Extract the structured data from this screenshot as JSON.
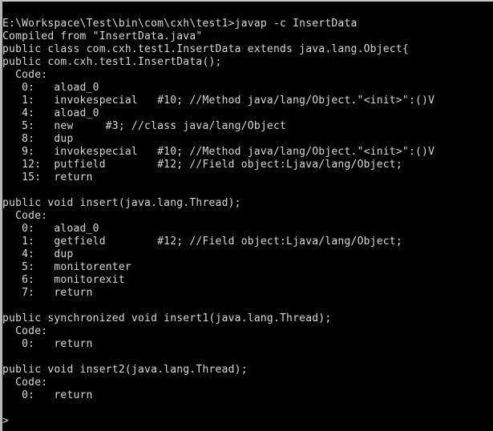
{
  "window": {
    "kind": "windows-command-prompt",
    "background_color": "#000000",
    "text_color": "#d8d8d8",
    "border_color": "#c6c6c6",
    "columns": 74,
    "rows": 32
  },
  "terminal": {
    "prompt_path": "E:\\Workspace\\Test\\bin\\com\\cxh\\test1>",
    "command": "javap -c InsertData",
    "final_prompt": ">",
    "lines": [
      "E:\\Workspace\\Test\\bin\\com\\cxh\\test1>javap -c InsertData",
      "Compiled from \"InsertData.java\"",
      "public class com.cxh.test1.InsertData extends java.lang.Object{",
      "public com.cxh.test1.InsertData();",
      "  Code:",
      "   0:   aload_0",
      "   1:   invokespecial   #10; //Method java/lang/Object.\"<init>\":()V",
      "   4:   aload_0",
      "   5:   new     #3; //class java/lang/Object",
      "   8:   dup",
      "   9:   invokespecial   #10; //Method java/lang/Object.\"<init>\":()V",
      "   12:  putfield        #12; //Field object:Ljava/lang/Object;",
      "   15:  return",
      "",
      "public void insert(java.lang.Thread);",
      "  Code:",
      "   0:   aload_0",
      "   1:   getfield        #12; //Field object:Ljava/lang/Object;",
      "   4:   dup",
      "   5:   monitorenter",
      "   6:   monitorexit",
      "   7:   return",
      "",
      "public synchronized void insert1(java.lang.Thread);",
      "  Code:",
      "   0:   return",
      "",
      "public void insert2(java.lang.Thread);",
      "  Code:",
      "   0:   return",
      "",
      ">"
    ]
  }
}
